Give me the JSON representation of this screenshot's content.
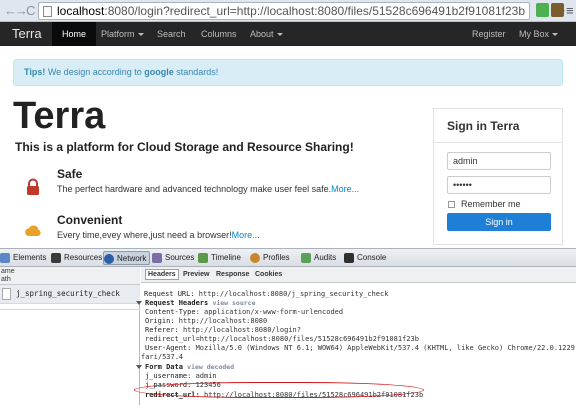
{
  "browser": {
    "url_host": "localhost",
    "url_rest": ":8080/login?redirect_url=http://localhost:8080/files/51528c696491b2f91081f23b"
  },
  "navbar": {
    "brand": "Terra",
    "items": [
      {
        "label": "Home"
      },
      {
        "label": "Platform"
      },
      {
        "label": "Search"
      },
      {
        "label": "Columns"
      },
      {
        "label": "About"
      },
      {
        "label": "Register"
      },
      {
        "label": "My Box"
      }
    ]
  },
  "alert": {
    "lead": "Tips!",
    "text_a": " We design according to ",
    "brand": "google",
    "text_b": " standards!"
  },
  "hero": {
    "title": "Terra",
    "subtitle": "This is a platform for Cloud Storage and Resource Sharing!",
    "features": [
      {
        "title": "Safe",
        "text": "The perfect hardware and advanced technology make user feel safe.",
        "more": "More..."
      },
      {
        "title": "Convenient",
        "text": "Every time,evey where,just need a browser!",
        "more": "More..."
      }
    ]
  },
  "signin": {
    "title": "Sign in Terra",
    "username": "admin",
    "password_mask": "••••••",
    "remember": "Remember me",
    "button": "Sign in"
  },
  "devtools": {
    "tabs": [
      "Elements",
      "Resources",
      "Network",
      "Sources",
      "Timeline",
      "Profiles",
      "Audits",
      "Console"
    ],
    "left_header_1": "ame",
    "left_header_2": "ath",
    "request_name": "j_spring_security_check",
    "subtabs": [
      "Headers",
      "Preview",
      "Response",
      "Cookies"
    ],
    "request_url_key": "Request URL:",
    "request_url": "http://localhost:8080/j_spring_security_check",
    "request_headers_label": "Request Headers",
    "view_source": "view source",
    "headers": [
      {
        "k": "Content-Type:",
        "v": "application/x-www-form-urlencoded"
      },
      {
        "k": "Origin:",
        "v": "http://localhost:8080"
      },
      {
        "k": "Referer:",
        "v": "http://localhost:8080/login?"
      },
      {
        "k": "",
        "v": "redirect_url=http://localhost:8080/files/51528c696491b2f91081f23b"
      },
      {
        "k": "User-Agent:",
        "v": "Mozilla/5.0 (Windows NT 6.1; WOW64) AppleWebKit/537.4 (KHTML, like Gecko) Chrome/22.0.1229.79"
      },
      {
        "k": "",
        "v": "fari/537.4"
      }
    ],
    "form_data_label": "Form Data",
    "view_decoded": "view decoded",
    "form": [
      {
        "k": "j_username:",
        "v": "admin"
      },
      {
        "k": "j_password:",
        "v": "123456"
      },
      {
        "k": "redirect_url:",
        "v": "http://localhost:8080/files/51528c696491b2f91081f23b"
      }
    ]
  },
  "colors": {
    "navbar_bg": "#262626",
    "alert_bg": "#d9edf7",
    "signin_button": "#1d7fd6",
    "annotation": "#d01818"
  }
}
